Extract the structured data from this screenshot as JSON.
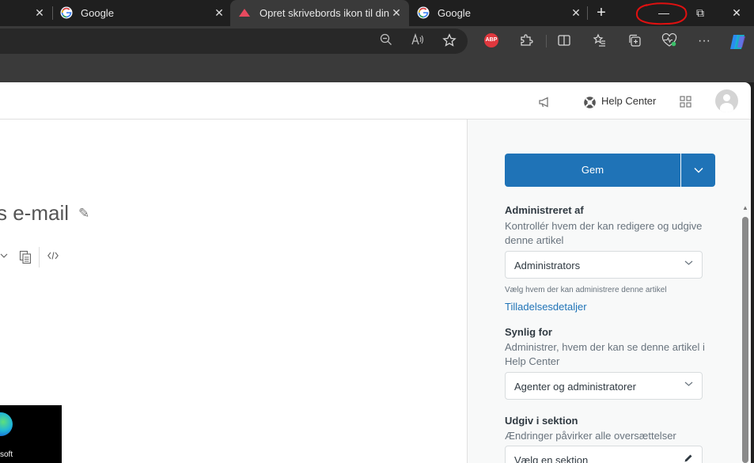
{
  "browser": {
    "tabs": [
      {
        "title": "Google",
        "close": "✕"
      },
      {
        "title": "Opret skrivebords ikon til din",
        "close": "✕"
      },
      {
        "title": "Google",
        "close": "✕"
      }
    ],
    "first_close": "✕",
    "new_tab": "+",
    "window": {
      "minimize": "—",
      "restore": "⧉",
      "close": "✕"
    },
    "extension_abp": "ABP"
  },
  "page": {
    "header": {
      "help_center": "Help Center"
    },
    "article_title": "s e-mail",
    "thumbnail_text": "soft"
  },
  "sidebar": {
    "save_label": "Gem",
    "managed_by": {
      "title": "Administreret af",
      "desc": "Kontrollér hvem der kan redigere og udgive denne artikel",
      "value": "Administrators",
      "hint": "Vælg hvem der kan administrere denne artikel",
      "link": "Tilladelsesdetaljer"
    },
    "visible_for": {
      "title": "Synlig for",
      "desc": "Administrer, hvem der kan se denne artikel i Help Center",
      "value": "Agenter og administratorer"
    },
    "publish_section": {
      "title": "Udgiv i sektion",
      "desc": "Ændringer påvirker alle oversættelser",
      "value": "Vælg en sektion"
    }
  },
  "colors": {
    "accent": "#1f73b7",
    "annotation": "#e01010"
  }
}
